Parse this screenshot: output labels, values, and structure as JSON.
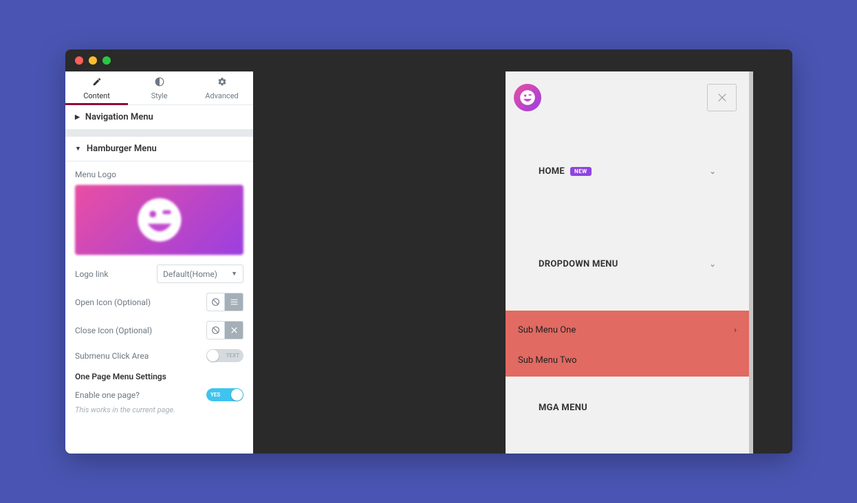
{
  "tabs": {
    "content": "Content",
    "style": "Style",
    "advanced": "Advanced"
  },
  "sections": {
    "navigation_menu": "Navigation Menu",
    "hamburger_menu": "Hamburger Menu"
  },
  "fields": {
    "menu_logo": "Menu Logo",
    "logo_link": "Logo link",
    "logo_link_value": "Default(Home)",
    "open_icon": "Open Icon (Optional)",
    "close_icon": "Close Icon (Optional)",
    "submenu_click": "Submenu Click Area",
    "submenu_click_value": "TEXT",
    "one_page_heading": "One Page Menu Settings",
    "enable_one_page": "Enable one page?",
    "enable_one_page_value": "YES",
    "hint": "This works in the current page."
  },
  "overlay": {
    "home": "HOME",
    "home_badge": "NEW",
    "dropdown": "DROPDOWN MENU",
    "sub1": "Sub Menu One",
    "sub2": "Sub Menu Two",
    "mega": "MGA MENU"
  }
}
